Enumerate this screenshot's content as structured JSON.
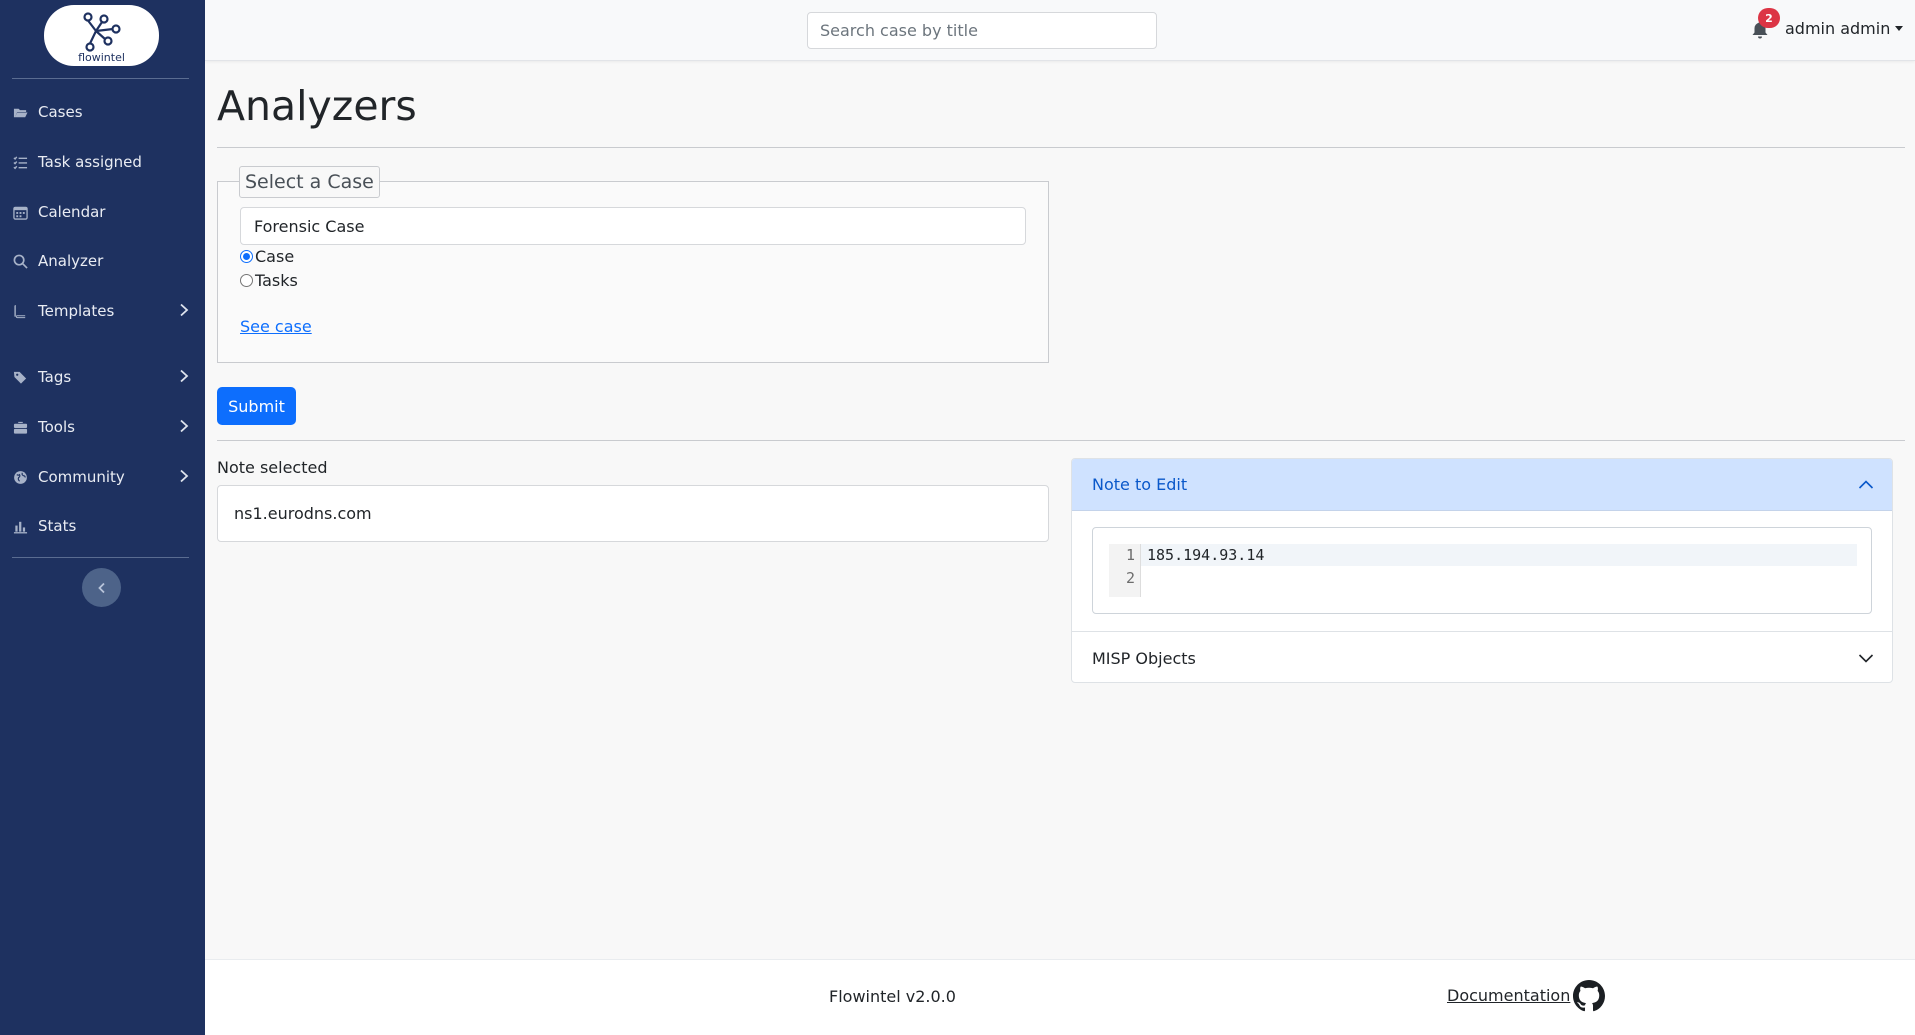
{
  "app": {
    "logo_text": "flowintel"
  },
  "sidebar": {
    "items": [
      {
        "label": "Cases",
        "icon": "folder-open-icon"
      },
      {
        "label": "Task assigned",
        "icon": "list-check-icon"
      },
      {
        "label": "Calendar",
        "icon": "calendar-icon"
      },
      {
        "label": "Analyzer",
        "icon": "search-icon"
      },
      {
        "label": "Templates",
        "icon": "book-icon",
        "expandable": true
      },
      {
        "label": "Tags",
        "icon": "tags-icon",
        "expandable": true
      },
      {
        "label": "Tools",
        "icon": "toolbox-icon",
        "expandable": true
      },
      {
        "label": "Community",
        "icon": "globe-icon",
        "expandable": true
      },
      {
        "label": "Stats",
        "icon": "chart-bar-icon"
      }
    ]
  },
  "header": {
    "search_placeholder": "Search case by title",
    "notification_count": "2",
    "user_name": "admin admin"
  },
  "main": {
    "title": "Analyzers",
    "select_case": {
      "legend": "Select a Case",
      "selected_case": "Forensic Case",
      "radio_case": "Case",
      "radio_tasks": "Tasks",
      "selected_radio": "Case",
      "see_case_link": "See case"
    },
    "submit_label": "Submit",
    "note_selected_label": "Note selected",
    "note_selected_value": "ns1.eurodns.com",
    "accordion": {
      "note_to_edit_title": "Note to Edit",
      "editor_lines": [
        {
          "num": "1",
          "text": "185.194.93.14"
        },
        {
          "num": "2",
          "text": ""
        }
      ],
      "misp_objects_title": "MISP Objects"
    }
  },
  "footer": {
    "version": "Flowintel v2.0.0",
    "docs_link": "Documentation"
  },
  "colors": {
    "sidebar_bg": "#1e3160",
    "primary": "#0d6efd",
    "accordion_active_bg": "#cfe2ff",
    "badge": "#dc3545"
  }
}
